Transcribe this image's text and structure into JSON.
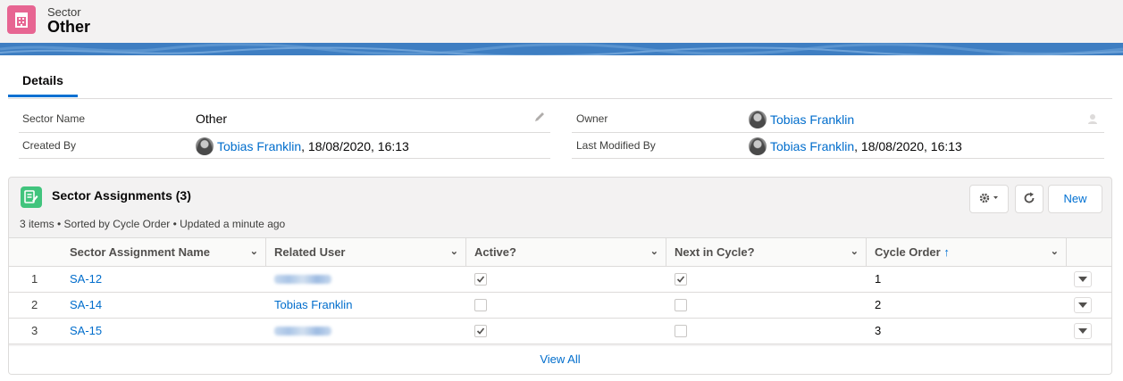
{
  "header": {
    "object_label": "Sector",
    "record_name": "Other",
    "icon": "building-icon"
  },
  "tabs": [
    {
      "label": "Details",
      "active": true
    }
  ],
  "fields": {
    "sector_name": {
      "label": "Sector Name",
      "value": "Other"
    },
    "owner": {
      "label": "Owner",
      "value": "Tobias Franklin"
    },
    "created_by": {
      "label": "Created By",
      "user": "Tobias Franklin",
      "date": ", 18/08/2020, 16:13"
    },
    "last_modified_by": {
      "label": "Last Modified By",
      "user": "Tobias Franklin",
      "date": ", 18/08/2020, 16:13"
    }
  },
  "related_list": {
    "title": "Sector Assignments (3)",
    "meta": "3 items • Sorted by Cycle Order • Updated a minute ago",
    "new_label": "New",
    "columns": [
      "Sector Assignment Name",
      "Related User",
      "Active?",
      "Next in Cycle?",
      "Cycle Order"
    ],
    "sorted_column": "Cycle Order",
    "rows": [
      {
        "num": "1",
        "name": "SA-12",
        "user": "",
        "user_blurred": true,
        "active": true,
        "next": true,
        "order": "1"
      },
      {
        "num": "2",
        "name": "SA-14",
        "user": "Tobias Franklin",
        "user_blurred": false,
        "active": false,
        "next": false,
        "order": "2"
      },
      {
        "num": "3",
        "name": "SA-15",
        "user": "",
        "user_blurred": true,
        "active": true,
        "next": false,
        "order": "3"
      }
    ],
    "view_all": "View All"
  },
  "colors": {
    "accent": "#0070d2",
    "header_icon": "#e76592",
    "card_icon": "#41c47d",
    "banner": "#3e7ec2"
  }
}
